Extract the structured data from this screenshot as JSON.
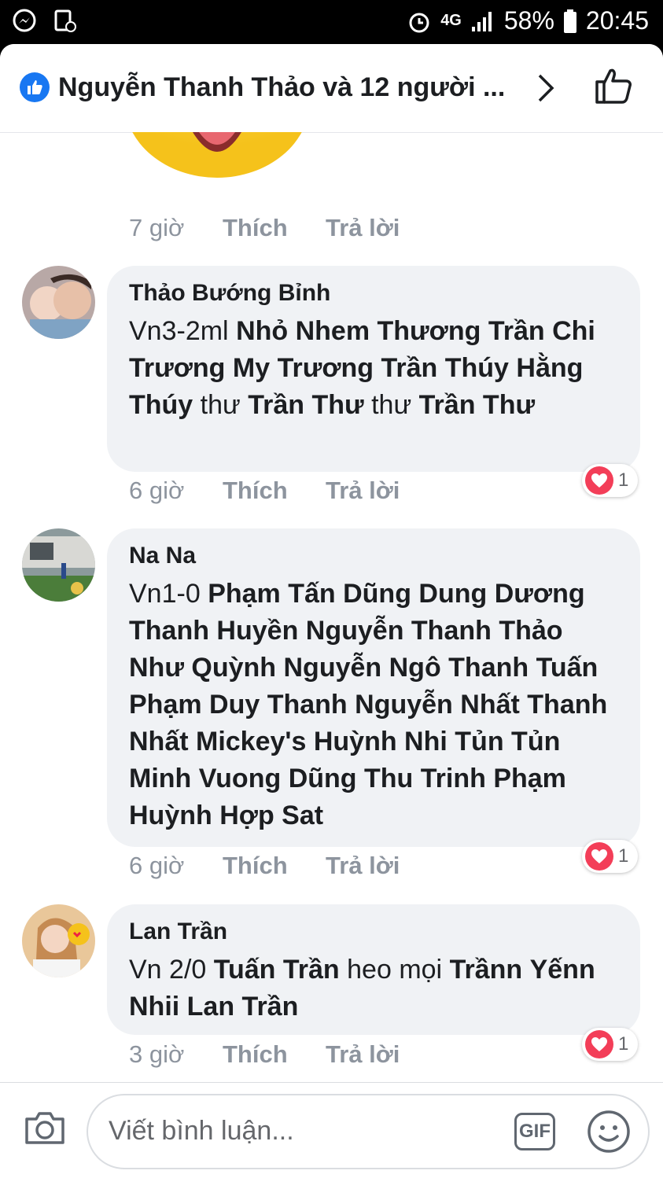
{
  "status_bar": {
    "network": "4G",
    "battery": "58%",
    "time": "20:45"
  },
  "header": {
    "title": "Nguyễn Thanh Thảo và 12 người ...",
    "icon_like": "like-icon",
    "icon_chevron": "chevron-right-icon",
    "icon_thumb": "thumbs-up-icon"
  },
  "prev_comment": {
    "time": "7 giờ",
    "like": "Thích",
    "reply": "Trả lời"
  },
  "comments": [
    {
      "author": "Thảo Bướng Bỉnh",
      "segments": [
        {
          "t": "Vn3-2ml  ",
          "b": false
        },
        {
          "t": "Nhỏ Nhem Thương Trần",
          "b": true
        },
        {
          "t": " ",
          "b": false
        },
        {
          "t": "Chi Trương My Trương Trần Thúy",
          "b": true
        },
        {
          "t": " ",
          "b": false
        },
        {
          "t": "Hằng Thúy",
          "b": true
        },
        {
          "t": " thư ",
          "b": false
        },
        {
          "t": "Trần Thư",
          "b": true
        },
        {
          "t": " thư ",
          "b": false
        },
        {
          "t": "Trần",
          "b": true
        },
        {
          "t": " ",
          "b": false
        },
        {
          "t": "Thư",
          "b": true
        }
      ],
      "time": "6 giờ",
      "like": "Thích",
      "reply": "Trả lời",
      "reactions": "1"
    },
    {
      "author": "Na Na",
      "segments": [
        {
          "t": "Vn1-0 ",
          "b": false
        },
        {
          "t": "Phạm Tấn Dũng Dung Dương",
          "b": true
        },
        {
          "t": " ",
          "b": false
        },
        {
          "t": "Thanh Huyền Nguyễn Thanh Thảo",
          "b": true
        },
        {
          "t": " ",
          "b": false
        },
        {
          "t": "Như Quỳnh Nguyễn Ngô Thanh Tuấn",
          "b": true
        },
        {
          "t": " ",
          "b": false
        },
        {
          "t": "Phạm Duy Thanh Nguyễn Nhất",
          "b": true
        },
        {
          "t": " ",
          "b": false
        },
        {
          "t": "Thanh Nhất Mickey's Huỳnh Nhi Tủn",
          "b": true
        },
        {
          "t": " ",
          "b": false
        },
        {
          "t": "Tủn Minh Vuong  Dũng Thu Trinh",
          "b": true
        },
        {
          "t": " ",
          "b": false
        },
        {
          "t": "Phạm Huỳnh  Hợp Sat",
          "b": true
        }
      ],
      "time": "6 giờ",
      "like": "Thích",
      "reply": "Trả lời",
      "reactions": "1"
    },
    {
      "author": "Lan Trần",
      "segments": [
        {
          "t": "Vn 2/0 ",
          "b": false
        },
        {
          "t": "Tuấn Trần",
          "b": true
        },
        {
          "t": " heo mọi ",
          "b": false
        },
        {
          "t": "Trầnn",
          "b": true
        },
        {
          "t": " ",
          "b": false
        },
        {
          "t": "Yếnn Nhii Lan Trần",
          "b": true
        }
      ],
      "time": "3 giờ",
      "like": "Thích",
      "reply": "Trả lời",
      "reactions": "1"
    }
  ],
  "composer": {
    "placeholder": "Viết bình luận...",
    "gif_label": "GIF"
  }
}
